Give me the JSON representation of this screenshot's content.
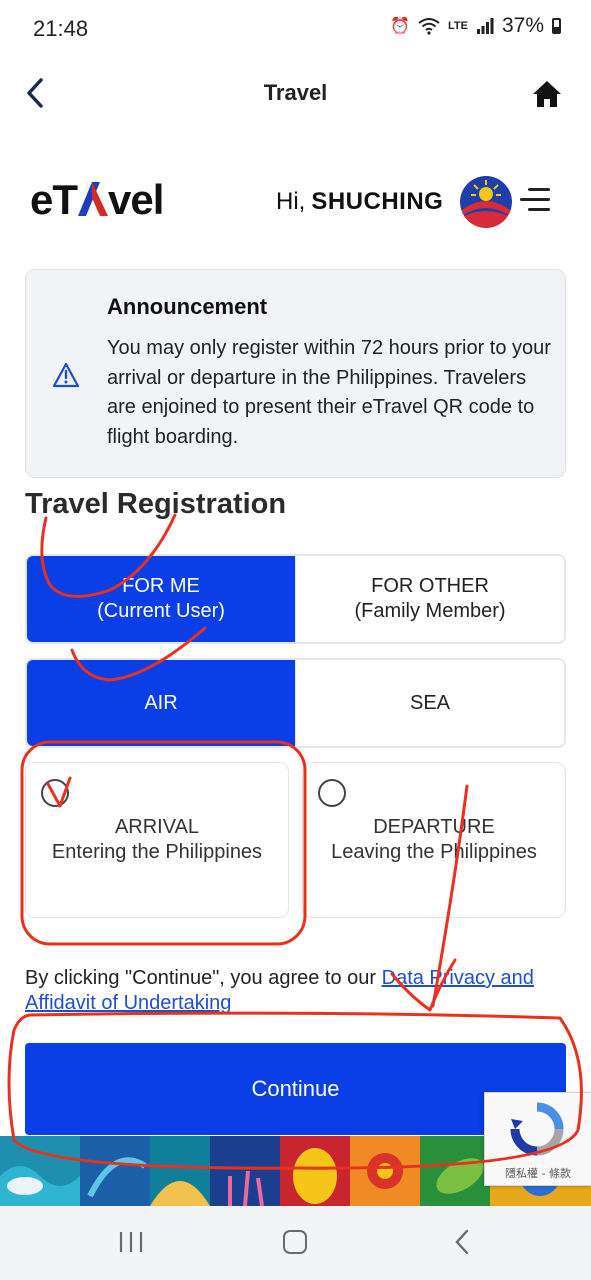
{
  "status_bar": {
    "time": "21:48",
    "battery": "37%",
    "network": "LTE"
  },
  "header": {
    "title": "Travel",
    "back_icon": "chevron-left-icon",
    "home_icon": "home-icon"
  },
  "brand": {
    "logo_text": "eTravel",
    "greeting": "Hi,",
    "username": "SHUCHING",
    "menu_icon": "hamburger-menu-icon"
  },
  "announcement": {
    "title": "Announcement",
    "body": "You may only register within 72 hours prior to your arrival or departure in the Philippines. Travelers are enjoined to present their eTravel QR code to flight boarding.",
    "icon": "warning-triangle-icon"
  },
  "registration": {
    "title": "Travel Registration",
    "who_options": [
      {
        "line1": "FOR ME",
        "line2": "(Current User)",
        "selected": true
      },
      {
        "line1": "FOR OTHER",
        "line2": "(Family Member)",
        "selected": false
      }
    ],
    "mode_options": [
      {
        "label": "AIR",
        "selected": true
      },
      {
        "label": "SEA",
        "selected": false
      }
    ],
    "direction_options": [
      {
        "line1": "ARRIVAL",
        "line2": "Entering the Philippines",
        "selected": false
      },
      {
        "line1": "DEPARTURE",
        "line2": "Leaving the Philippines",
        "selected": false
      }
    ]
  },
  "terms": {
    "prefix": "By clicking \"Continue\", you agree to our ",
    "link_text": "Data Privacy and Affidavit of Undertaking"
  },
  "continue_label": "Continue",
  "recaptcha_text": "隱私權 - 條款",
  "colors": {
    "primary": "#0a3ee6",
    "annotation": "#e8321f",
    "link": "#1f4fd0"
  }
}
